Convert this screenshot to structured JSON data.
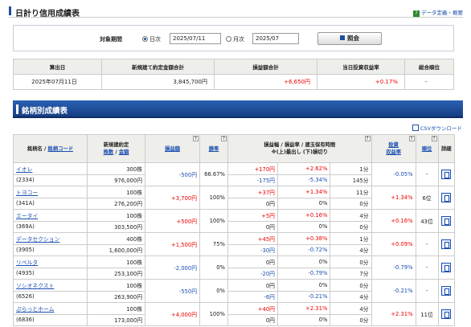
{
  "header": {
    "title": "日計り信用成績表",
    "help_link": "データ定義・概要",
    "help_icon": "help-icon"
  },
  "search": {
    "label": "対象期間",
    "daily_label": "日次",
    "daily_value": "2025/07/11",
    "daily_selected": true,
    "monthly_label": "月次",
    "monthly_value": "2025/07",
    "submit_label": "照会"
  },
  "summary": {
    "headers": [
      "算出日",
      "新規建て約定金額合計",
      "損益額合計",
      "当日投資収益率",
      "総合順位"
    ],
    "row": [
      "2025年07月11日",
      "3,845,700円",
      "+6,650円",
      "+0.17%",
      "-"
    ]
  },
  "section": {
    "title": "銘柄別成績表",
    "csv_label": "CSVダウンロード"
  },
  "table": {
    "headers": {
      "name_a": "銘柄名 /",
      "name_b": "銘柄コード",
      "contract_a": "新規建約定",
      "contract_b": "株数",
      "contract_c": "金額",
      "pl": "損益額",
      "win": "勝率",
      "pl_detail_a": "損益幅 / 損益率 / 建玉保有時間",
      "pl_detail_b": "※(上)最出し (下)損切り",
      "roi_a": "投資",
      "roi_b": "収益率",
      "rank": "順位",
      "detail": "詳細"
    },
    "rows": [
      {
        "name": "イオレ",
        "code": "(2334)",
        "shares": "300株",
        "amount": "976,000円",
        "pl": "-500円",
        "pl_color": "blue",
        "win": "66.67%",
        "up_w": "+170円",
        "up_r": "+2.62%",
        "up_t": "1分",
        "dn_w": "-175円",
        "dn_r": "-5.34%",
        "dn_t": "145分",
        "roi": "-0.05%",
        "roi_color": "blue",
        "rank": "-"
      },
      {
        "name": "トヨコー",
        "code": "(341A)",
        "shares": "100株",
        "amount": "276,200円",
        "pl": "+3,700円",
        "pl_color": "red",
        "win": "100%",
        "up_w": "+37円",
        "up_r": "+1.34%",
        "up_t": "11分",
        "dn_w": "0円",
        "dn_r": "0%",
        "dn_t": "0分",
        "roi": "+1.34%",
        "roi_color": "red",
        "rank": "6位"
      },
      {
        "name": "エータイ",
        "code": "(369A)",
        "shares": "100株",
        "amount": "303,500円",
        "pl": "+500円",
        "pl_color": "red",
        "win": "100%",
        "up_w": "+5円",
        "up_r": "+0.16%",
        "up_t": "4分",
        "dn_w": "0円",
        "dn_r": "0%",
        "dn_t": "0分",
        "roi": "+0.16%",
        "roi_color": "red",
        "rank": "43位"
      },
      {
        "name": "データセクション",
        "code": "(3905)",
        "shares": "400株",
        "amount": "1,600,000円",
        "pl": "+1,500円",
        "pl_color": "red",
        "win": "75%",
        "up_w": "+45円",
        "up_r": "+0.38%",
        "up_t": "1分",
        "dn_w": "-30円",
        "dn_r": "-0.72%",
        "dn_t": "4分",
        "roi": "+0.09%",
        "roi_color": "red",
        "rank": "-"
      },
      {
        "name": "リベルタ",
        "code": "(4935)",
        "shares": "100株",
        "amount": "253,100円",
        "pl": "-2,000円",
        "pl_color": "blue",
        "win": "0%",
        "up_w": "0円",
        "up_r": "0%",
        "up_t": "0分",
        "dn_w": "-20円",
        "dn_r": "-0.79%",
        "dn_t": "7分",
        "roi": "-0.79%",
        "roi_color": "blue",
        "rank": "-"
      },
      {
        "name": "ソシオネクスト",
        "code": "(6526)",
        "shares": "100株",
        "amount": "263,900円",
        "pl": "-550円",
        "pl_color": "blue",
        "win": "0%",
        "up_w": "0円",
        "up_r": "0%",
        "up_t": "0分",
        "dn_w": "-6円",
        "dn_r": "-0.21%",
        "dn_t": "4分",
        "roi": "-0.21%",
        "roi_color": "blue",
        "rank": "-"
      },
      {
        "name": "ぷらっとホーム",
        "code": "(6836)",
        "shares": "100株",
        "amount": "173,000円",
        "pl": "+4,000円",
        "pl_color": "red",
        "win": "100%",
        "up_w": "+40円",
        "up_r": "+2.31%",
        "up_t": "4分",
        "dn_w": "0円",
        "dn_r": "0%",
        "dn_t": "0分",
        "roi": "+2.31%",
        "roi_color": "red",
        "rank": "11位"
      }
    ]
  }
}
